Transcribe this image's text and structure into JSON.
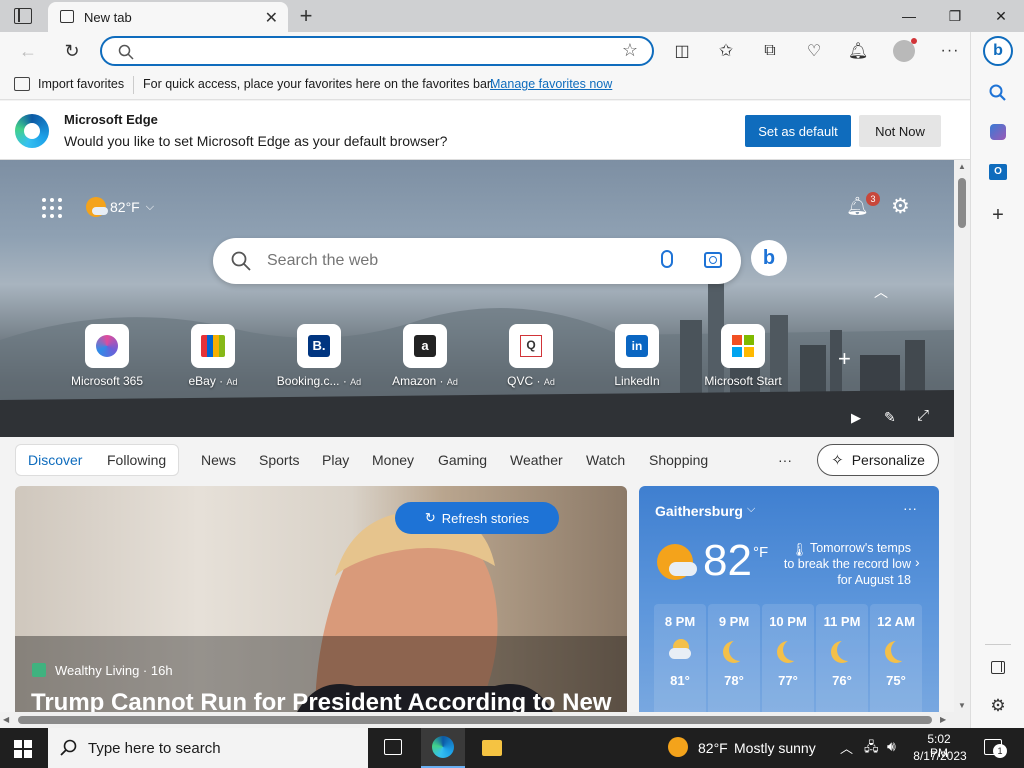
{
  "browser": {
    "tab": {
      "title": "New tab"
    },
    "address": {
      "value": "",
      "placeholder": ""
    },
    "favorites_bar": {
      "import_label": "Import favorites",
      "message": "For quick access, place your favorites here on the favorites bar.",
      "manage_link": "Manage favorites now"
    },
    "infobar": {
      "title": "Microsoft Edge",
      "message": "Would you like to set Microsoft Edge as your default browser?",
      "primary_button": "Set as default",
      "secondary_button": "Not Now"
    }
  },
  "newtab": {
    "weather_temp": "82°F",
    "notifications_count": "3",
    "search_placeholder": "Search the web",
    "quick_links": [
      {
        "name": "Microsoft 365",
        "ad": ""
      },
      {
        "name": "eBay",
        "ad": "Ad"
      },
      {
        "name": "Booking.c...",
        "ad": "Ad"
      },
      {
        "name": "Amazon",
        "ad": "Ad"
      },
      {
        "name": "QVC",
        "ad": "Ad"
      },
      {
        "name": "LinkedIn",
        "ad": ""
      },
      {
        "name": "Microsoft Start",
        "ad": ""
      }
    ],
    "feed_tabs": [
      "Discover",
      "Following",
      "News",
      "Sports",
      "Play",
      "Money",
      "Gaming",
      "Weather",
      "Watch",
      "Shopping"
    ],
    "more_label": "···",
    "personalize_label": "Personalize",
    "refresh_label": "Refresh stories",
    "hero_story": {
      "source": "Wealthy Living · 16h",
      "headline": "Trump Cannot Run for President According to New"
    },
    "weather": {
      "location": "Gaithersburg",
      "temp": "82",
      "unit": "°F",
      "note": "Tomorrow's temps to break the record low for August 18",
      "hours": [
        {
          "time": "8 PM",
          "icon": "partly-cloudy-night-icon",
          "temp": "81°"
        },
        {
          "time": "9 PM",
          "icon": "moon-icon",
          "temp": "78°"
        },
        {
          "time": "10 PM",
          "icon": "moon-icon",
          "temp": "77°"
        },
        {
          "time": "11 PM",
          "icon": "moon-icon",
          "temp": "76°"
        },
        {
          "time": "12 AM",
          "icon": "moon-icon",
          "temp": "75°"
        }
      ]
    }
  },
  "taskbar": {
    "search_placeholder": "Type here to search",
    "weather": "82°F",
    "weather_desc": "Mostly sunny",
    "time": "5:02 PM",
    "date": "8/17/2023",
    "notification_count": "1"
  },
  "colors": {
    "accent": "#0f6cbd",
    "hero_sky": "#8fa1b3",
    "weather_card": "#4c88d6",
    "taskbar": "#1f1f1f"
  }
}
